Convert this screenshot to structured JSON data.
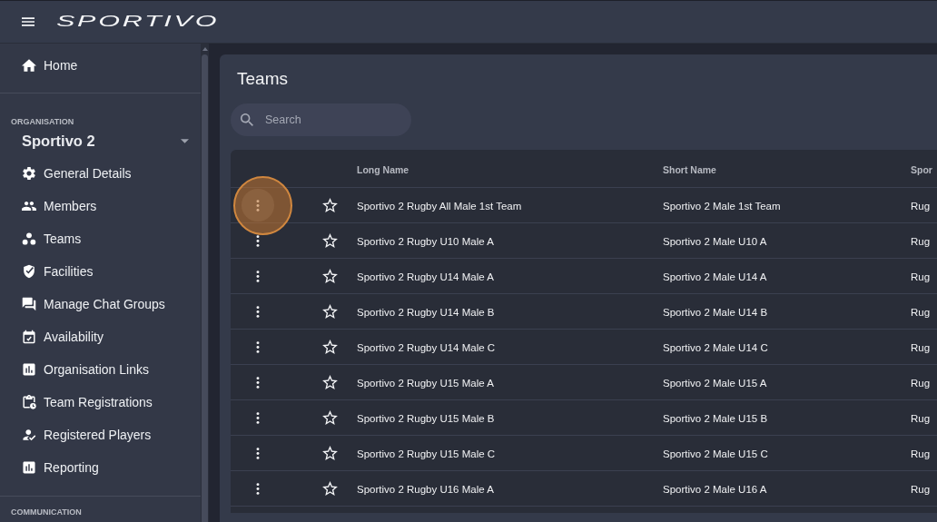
{
  "topbar": {
    "logo": "SPORTIVO"
  },
  "sidebar": {
    "home": "Home",
    "section_label": "ORGANISATION",
    "organisation": "Sportivo 2",
    "items": [
      "General Details",
      "Members",
      "Teams",
      "Facilities",
      "Manage Chat Groups",
      "Availability",
      "Organisation Links",
      "Team Registrations",
      "Registered Players",
      "Reporting"
    ],
    "next_section_label": "COMMUNICATION"
  },
  "page": {
    "title": "Teams",
    "search": {
      "placeholder": "Search"
    }
  },
  "table": {
    "columns": [
      "Long Name",
      "Short Name",
      "Spor"
    ],
    "rows": [
      {
        "long_name": "Sportivo 2 Rugby All Male 1st Team",
        "short_name": "Sportivo 2 Male 1st Team",
        "column_3": "Rug",
        "starred": false,
        "highlighted": true
      },
      {
        "long_name": "Sportivo 2 Rugby U10 Male A",
        "short_name": "Sportivo 2 Male U10 A",
        "column_3": "Rug",
        "starred": false,
        "highlighted": false
      },
      {
        "long_name": "Sportivo 2 Rugby U14 Male A",
        "short_name": "Sportivo 2 Male U14 A",
        "column_3": "Rug",
        "starred": false,
        "highlighted": false
      },
      {
        "long_name": "Sportivo 2 Rugby U14 Male B",
        "short_name": "Sportivo 2 Male U14 B",
        "column_3": "Rug",
        "starred": false,
        "highlighted": false
      },
      {
        "long_name": "Sportivo 2 Rugby U14 Male C",
        "short_name": "Sportivo 2 Male U14 C",
        "column_3": "Rug",
        "starred": false,
        "highlighted": false
      },
      {
        "long_name": "Sportivo 2 Rugby U15 Male A",
        "short_name": "Sportivo 2 Male U15 A",
        "column_3": "Rug",
        "starred": false,
        "highlighted": false
      },
      {
        "long_name": "Sportivo 2 Rugby U15 Male B",
        "short_name": "Sportivo 2 Male U15 B",
        "column_3": "Rug",
        "starred": false,
        "highlighted": false
      },
      {
        "long_name": "Sportivo 2 Rugby U15 Male C",
        "short_name": "Sportivo 2 Male U15 C",
        "column_3": "Rug",
        "starred": false,
        "highlighted": false
      },
      {
        "long_name": "Sportivo 2 Rugby U16 Male A",
        "short_name": "Sportivo 2 Male U16 A",
        "column_3": "Rug",
        "starred": false,
        "highlighted": false
      }
    ]
  }
}
